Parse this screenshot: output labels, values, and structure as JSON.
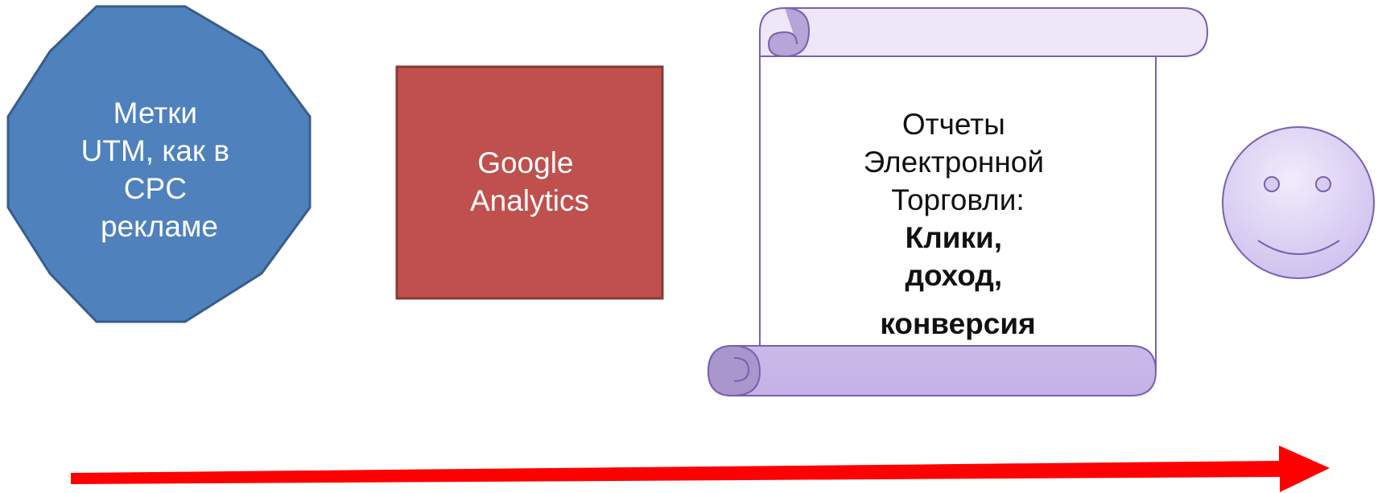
{
  "octagon": {
    "lines": [
      "Метки",
      "UTM, как в",
      "CPC",
      "рекламе"
    ],
    "fill": "#4f81bd",
    "stroke": "#385d8a"
  },
  "square": {
    "lines": [
      "Google",
      "Analytics"
    ],
    "fill": "#c0504d",
    "stroke": "#8c3836"
  },
  "scroll": {
    "lines": [
      "Отчеты",
      "Электронной",
      "Торговли:"
    ],
    "bold_lines": [
      "Клики,",
      "доход,",
      "конверсия"
    ],
    "fill_top": "#ede7f8",
    "fill_bottom": "#c4b2e6",
    "stroke": "#7a60b0"
  },
  "smiley": {
    "icon": "smiley-face-icon",
    "fill": "#d8ccf0",
    "stroke": "#7a60b0"
  },
  "arrow": {
    "icon": "right-arrow-icon",
    "color": "#ff0000"
  }
}
